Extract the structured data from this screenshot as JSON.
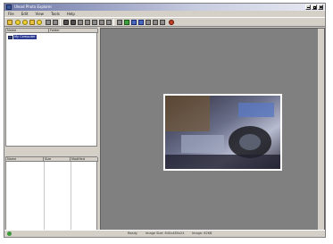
{
  "window": {
    "title": "Ulead Photo Explorer"
  },
  "menu": [
    "File",
    "Edit",
    "View",
    "Tools",
    "Help"
  ],
  "tree": {
    "headers": [
      "Name",
      "Folder"
    ],
    "item_label": "My Computer"
  },
  "file_list": {
    "headers": [
      "Name",
      "Size",
      "Modified"
    ]
  },
  "status": {
    "segment_1": "Ready",
    "segment_2": "Image Size: 640x480x24",
    "segment_3": "Image: 62KB"
  },
  "icons": [
    "app-icon",
    "minimize-icon",
    "maximize-icon",
    "close-icon",
    "folder-icon",
    "status-icon"
  ],
  "colors": {
    "viewer_bg": "#808080",
    "selection": "#2a3a90"
  }
}
